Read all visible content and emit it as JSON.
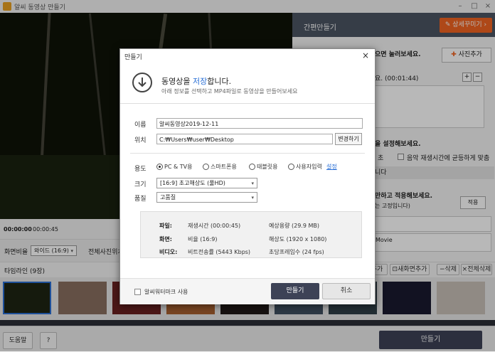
{
  "window": {
    "title": "알씨 동영상 만들기"
  },
  "main": {
    "time_current": "00:00:00",
    "time_total": "00:00:45",
    "ratio_label": "화면비율",
    "ratio_value": "와이드 (16:9)",
    "all_photo_label": "전체사진위치"
  },
  "right_panel": {
    "title": "간편만들기",
    "detail_button": "상세꾸미기",
    "hint1": "으면 눌러보세요.",
    "add_photo": "사진추가",
    "hint2": "요. (00:01:44)",
    "hint3": "을 설정해보세요.",
    "sec_label": "초",
    "music_sync": "음악 재생시간에 균등하게 맞춤",
    "hint4": "니다",
    "hint5": "만하고 적용해보세요.",
    "hint6": "는 고정입니다)",
    "apply": "적용",
    "movie_text": "Movie"
  },
  "timeline": {
    "label": "타임라인 (9장)",
    "add": "추가",
    "new_screen": "새화면추가",
    "delete": "삭제",
    "delete_all": "전체삭제"
  },
  "bottom": {
    "help": "도움말",
    "question": "?",
    "make": "만들기"
  },
  "dialog": {
    "window_title": "만들기",
    "close": "×",
    "heading_pre": "동영상을 ",
    "heading_hl": "저장",
    "heading_post": "합니다.",
    "subheading": "아래 정보를 선택하고 MP4파일로 동영상을 만들어보세요",
    "name_label": "이름",
    "name_value": "알씨동영상2019-12-11",
    "location_label": "위치",
    "location_value": "C:₩Users₩user₩Desktop",
    "change_button": "변경하기",
    "usage_label": "용도",
    "usage_options": [
      "PC & TV용",
      "스마트폰용",
      "태블릿용",
      "사용자입력"
    ],
    "settings_link": "설정",
    "size_label": "크기",
    "size_value": "[16:9] 초고해상도 (풀HD)",
    "quality_label": "품질",
    "quality_value": "고품질",
    "info": {
      "file_label": "파일:",
      "play_time": "재생시간 (00:00:45)",
      "expected_size": "예상용량 (29.9 MB)",
      "screen_label": "화면:",
      "ratio": "비율 (16:9)",
      "resolution": "해상도 (1920 x 1080)",
      "video_label": "비디오:",
      "bitrate": "비트전송률 (5443 Kbps)",
      "fps": "초당프레임수 (24 fps)"
    },
    "watermark_label": "알씨워터마크 사용",
    "make_button": "만들기",
    "cancel_button": "취소"
  },
  "colors": {
    "accent": "#f26522",
    "primary_dark": "#3d4256",
    "link": "#2a6fd6"
  }
}
